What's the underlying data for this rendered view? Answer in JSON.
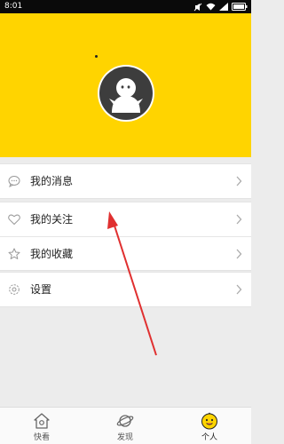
{
  "status_bar": {
    "time": "8:01",
    "icons": [
      "mute-icon",
      "wifi-icon",
      "signal-icon",
      "battery-icon"
    ]
  },
  "header": {
    "background_color": "#ffd400",
    "avatar_icon": "default-avatar"
  },
  "menu": {
    "messages": {
      "label": "我的消息",
      "icon": "chat-bubble-icon"
    },
    "follows": {
      "label": "我的关注",
      "icon": "heart-icon"
    },
    "favorites": {
      "label": "我的收藏",
      "icon": "star-icon"
    },
    "settings": {
      "label": "设置",
      "icon": "gear-icon"
    }
  },
  "tabbar": {
    "tabs": [
      {
        "label": "快看",
        "icon": "home-icon",
        "active": false
      },
      {
        "label": "发现",
        "icon": "planet-icon",
        "active": false
      },
      {
        "label": "个人",
        "icon": "face-icon",
        "active": true
      }
    ]
  },
  "annotation": {
    "type": "red-arrow",
    "color": "#e03030",
    "points_to": "我的关注"
  }
}
